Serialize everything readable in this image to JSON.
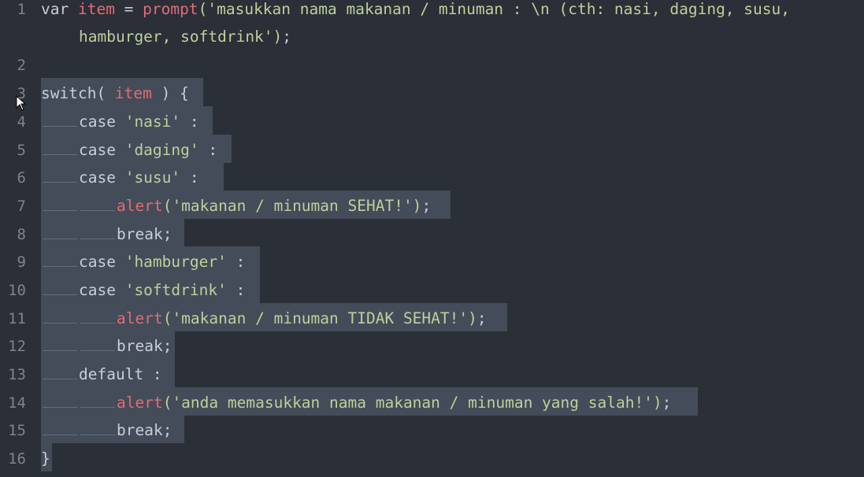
{
  "lines": [
    {
      "num": "1",
      "segs": [
        [
          "var ",
          "kw"
        ],
        [
          "item",
          "var"
        ],
        [
          " = ",
          "pn"
        ],
        [
          "prompt",
          "fn"
        ],
        [
          "('masukkan nama makanan / minuman : \\n (cth: nasi, daging, susu,",
          "str"
        ]
      ]
    },
    {
      "num": "",
      "segs": [
        [
          "hamburger, softdrink')",
          "str"
        ],
        [
          ";",
          "pn"
        ]
      ]
    },
    {
      "num": "2",
      "segs": []
    },
    {
      "num": "3",
      "segs": [
        [
          "switch( ",
          "kw"
        ],
        [
          "item",
          "var"
        ],
        [
          " ) {",
          "pn"
        ]
      ]
    },
    {
      "num": "4",
      "segs": [
        [
          "case ",
          "kw"
        ],
        [
          "'nasi'",
          "str"
        ],
        [
          " :",
          "pn"
        ]
      ]
    },
    {
      "num": "5",
      "segs": [
        [
          "case ",
          "kw"
        ],
        [
          "'daging'",
          "str"
        ],
        [
          " :",
          "pn"
        ]
      ]
    },
    {
      "num": "6",
      "segs": [
        [
          "case ",
          "kw"
        ],
        [
          "'susu'",
          "str"
        ],
        [
          " :",
          "pn"
        ]
      ]
    },
    {
      "num": "7",
      "segs": [
        [
          "alert",
          "fn"
        ],
        [
          "('makanan / minuman SEHAT!')",
          "str"
        ],
        [
          ";",
          "pn"
        ]
      ]
    },
    {
      "num": "8",
      "segs": [
        [
          "break;",
          "kw"
        ]
      ]
    },
    {
      "num": "9",
      "segs": [
        [
          "case ",
          "kw"
        ],
        [
          "'hamburger'",
          "str"
        ],
        [
          " :",
          "pn"
        ]
      ]
    },
    {
      "num": "10",
      "segs": [
        [
          "case ",
          "kw"
        ],
        [
          "'softdrink'",
          "str"
        ],
        [
          " :",
          "pn"
        ]
      ]
    },
    {
      "num": "11",
      "segs": [
        [
          "alert",
          "fn"
        ],
        [
          "('makanan / minuman TIDAK SEHAT!')",
          "str"
        ],
        [
          ";",
          "pn"
        ]
      ]
    },
    {
      "num": "12",
      "segs": [
        [
          "break;",
          "kw"
        ]
      ]
    },
    {
      "num": "13",
      "segs": [
        [
          "default :",
          "kw"
        ]
      ]
    },
    {
      "num": "14",
      "segs": [
        [
          "alert",
          "fn"
        ],
        [
          "('anda memasukkan nama makanan / minuman yang salah!')",
          "str"
        ],
        [
          ";",
          "pn"
        ]
      ]
    },
    {
      "num": "15",
      "segs": [
        [
          "break;",
          "kw"
        ]
      ]
    },
    {
      "num": "16",
      "segs": [
        [
          "}",
          "pn"
        ]
      ]
    }
  ]
}
